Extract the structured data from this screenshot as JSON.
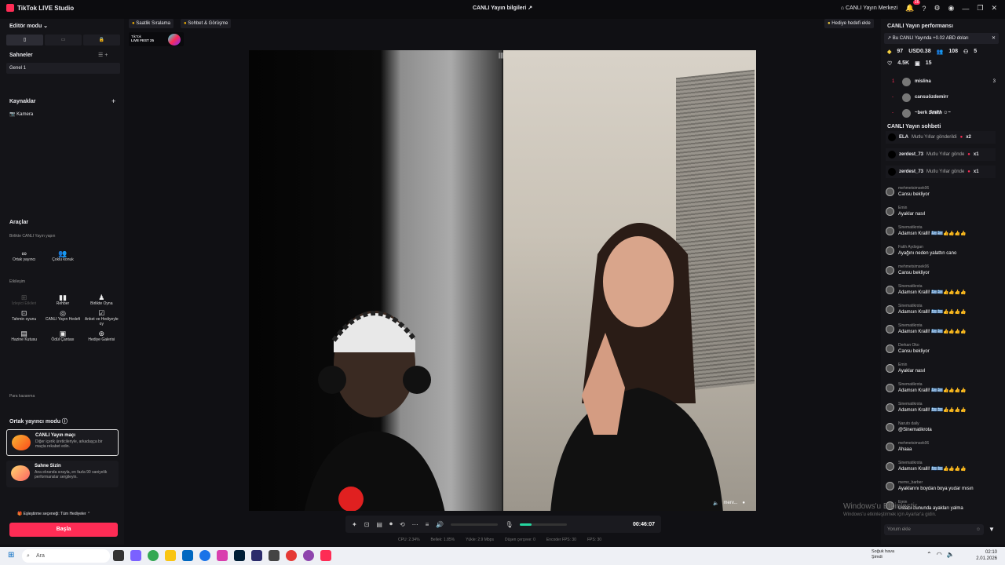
{
  "titlebar": {
    "app_name": "TikTok LIVE Studio",
    "center_title": "CANLI Yayın bilgileri",
    "live_center": "CANLI Yayın Merkezi",
    "notif_count": "16"
  },
  "left": {
    "editor_mode": "Editör modu",
    "scenes_title": "Sahneler",
    "scene_item": "Genel 1",
    "sources_title": "Kaynaklar",
    "source_item": "Kamera",
    "tools_title": "Araçlar",
    "tools_subtitle": "Birlikte CANLI Yayın yapın",
    "tools_row1": [
      {
        "icon": "∞",
        "label": "Ortak yayıncı"
      },
      {
        "icon": "👥",
        "label": "Çoklu konuk"
      }
    ],
    "interaction_label": "Etkileşim",
    "tools_interaction": [
      {
        "icon": "⊞",
        "label": "İzleyici Etkileri",
        "dim": true
      },
      {
        "icon": "▮▮",
        "label": "Rehber"
      },
      {
        "icon": "♟",
        "label": "Birlikte Oyna"
      },
      {
        "icon": "⊡",
        "label": "Tahmin oyunu"
      },
      {
        "icon": "◎",
        "label": "CANLI Yayın Hedefi"
      },
      {
        "icon": "☑",
        "label": "Anket ve Hediyeyle oy"
      },
      {
        "icon": "▤",
        "label": "Hazine Kutusu"
      },
      {
        "icon": "▣",
        "label": "Ödül Çantası"
      },
      {
        "icon": "⊛",
        "label": "Hediye Galerisi"
      }
    ],
    "earn_label": "Para kazanma",
    "cohost_mode": "Ortak yayıncı modu",
    "card1_title": "CANLI Yayın maçı",
    "card1_desc": "Diğer içerik üreticileriyle, arkadaşça bir maçta rekabet edin.",
    "card2_title": "Sahne Sizin",
    "card2_desc": "Ana ekranda sırayla, en fazla 90 saniyelik performanslar sergileyin.",
    "match_option": "Eşleştirme seçeneği: Tüm Hediyeler",
    "start": "Başla"
  },
  "preview": {
    "tag1": "Saatlik Sıralama",
    "tag2": "Sohbet & Görüşme",
    "gift_goal": "Hediye hedefi ekle",
    "fest_line1": "TikTok",
    "fest_line2": "LIVE FEST 25",
    "guest_name": "merv...",
    "timer": "00:46:07",
    "stats": [
      "CPU: 2.34%",
      "Bellek: 1.85%",
      "Yükle: 2.9 Mbps",
      "Düşen çerçeve: 0",
      "Encoder FPS: 30",
      "FPS: 30"
    ]
  },
  "right": {
    "perf_title": "CANLI Yayın performansı",
    "perf_banner": "Bu CANLI Yayında +0.02 ABD doları",
    "stat_diamonds": "97",
    "stat_usd": "USD0.38",
    "stat_viewers": "108",
    "stat_new": "5",
    "stat_likes": "4.5K",
    "stat_gifters": "15",
    "rankings": [
      {
        "rank": "1",
        "name": "mislina",
        "score": "3"
      },
      {
        "rank": "-",
        "name": "cansuözdemirr",
        "score": ""
      },
      {
        "rank": "-",
        "name": "~berk 𝑺𝒎𝒊𝒕𝒉 ☺~",
        "score": ""
      }
    ],
    "chat_title": "CANLI Yayın sohbeti",
    "gift_events": [
      {
        "user": "ELA",
        "text": "Mutlu Yıllar gönderildi",
        "count": "x2"
      },
      {
        "user": "zerdest_73",
        "text": "Mutlu Yıllar gönde",
        "count": "x1"
      },
      {
        "user": "zerdest_73",
        "text": "Mutlu Yıllar gönde",
        "count": "x1"
      }
    ],
    "messages": [
      {
        "user": "mehmetsimsek06",
        "text": "Cansu bekliyor"
      },
      {
        "user": "Emin",
        "text": "Ayaklar nasıl"
      },
      {
        "user": "Sinematikrota",
        "text": "Adamsın Kralll! 🇬🇷🇬🇷👍👍👍👍"
      },
      {
        "user": "Fatih Aydogan",
        "text": "Ayağını neden yalattın cano"
      },
      {
        "user": "mehmetsimsek06",
        "text": "Cansu bekliyor"
      },
      {
        "user": "Sinematikrota",
        "text": "Adamsın Kralll! 🇬🇷🇬🇷👍👍👍👍"
      },
      {
        "user": "Sinematikrota",
        "text": "Adamsın Kralll! 🇬🇷🇬🇷👍👍👍👍"
      },
      {
        "user": "Sinematikrota",
        "text": "Adamsın Kralll! 🇬🇷🇬🇷👍👍👍👍"
      },
      {
        "user": "Derkan Oko",
        "text": "Cansu bekliyor"
      },
      {
        "user": "Emin",
        "text": "Ayaklar nasıl"
      },
      {
        "user": "Sinematikrota",
        "text": "Adamsın Kralll! 🇬🇷🇬🇷👍👍👍👍"
      },
      {
        "user": "Sinematikrota",
        "text": "Adamsın Kralll! 🇬🇷🇬🇷👍👍👍👍"
      },
      {
        "user": "Naruto daily",
        "text": "@Sinematikrota"
      },
      {
        "user": "mehmetsimsek06",
        "text": "Ahaaa"
      },
      {
        "user": "Sinematikrota",
        "text": "Adamsın Kralll! 🇬🇷🇬🇷👍👍👍👍"
      },
      {
        "user": "memo_barber",
        "text": "Ayaklarını boydan boya yudar mısın"
      },
      {
        "user": "Emin",
        "text": "Ustanı bununda ayakları yalma"
      }
    ],
    "comment_placeholder": "Yorum ekle",
    "watermark1": "Windows'u Etkinleştir",
    "watermark2": "Windows'u etkinleştirmek için Ayarlar'a gidin."
  },
  "taskbar": {
    "search": "Ara",
    "weather1": "Soğuk hava",
    "weather2": "Şimdi",
    "time": "02:10",
    "date": "2.01.2026"
  }
}
